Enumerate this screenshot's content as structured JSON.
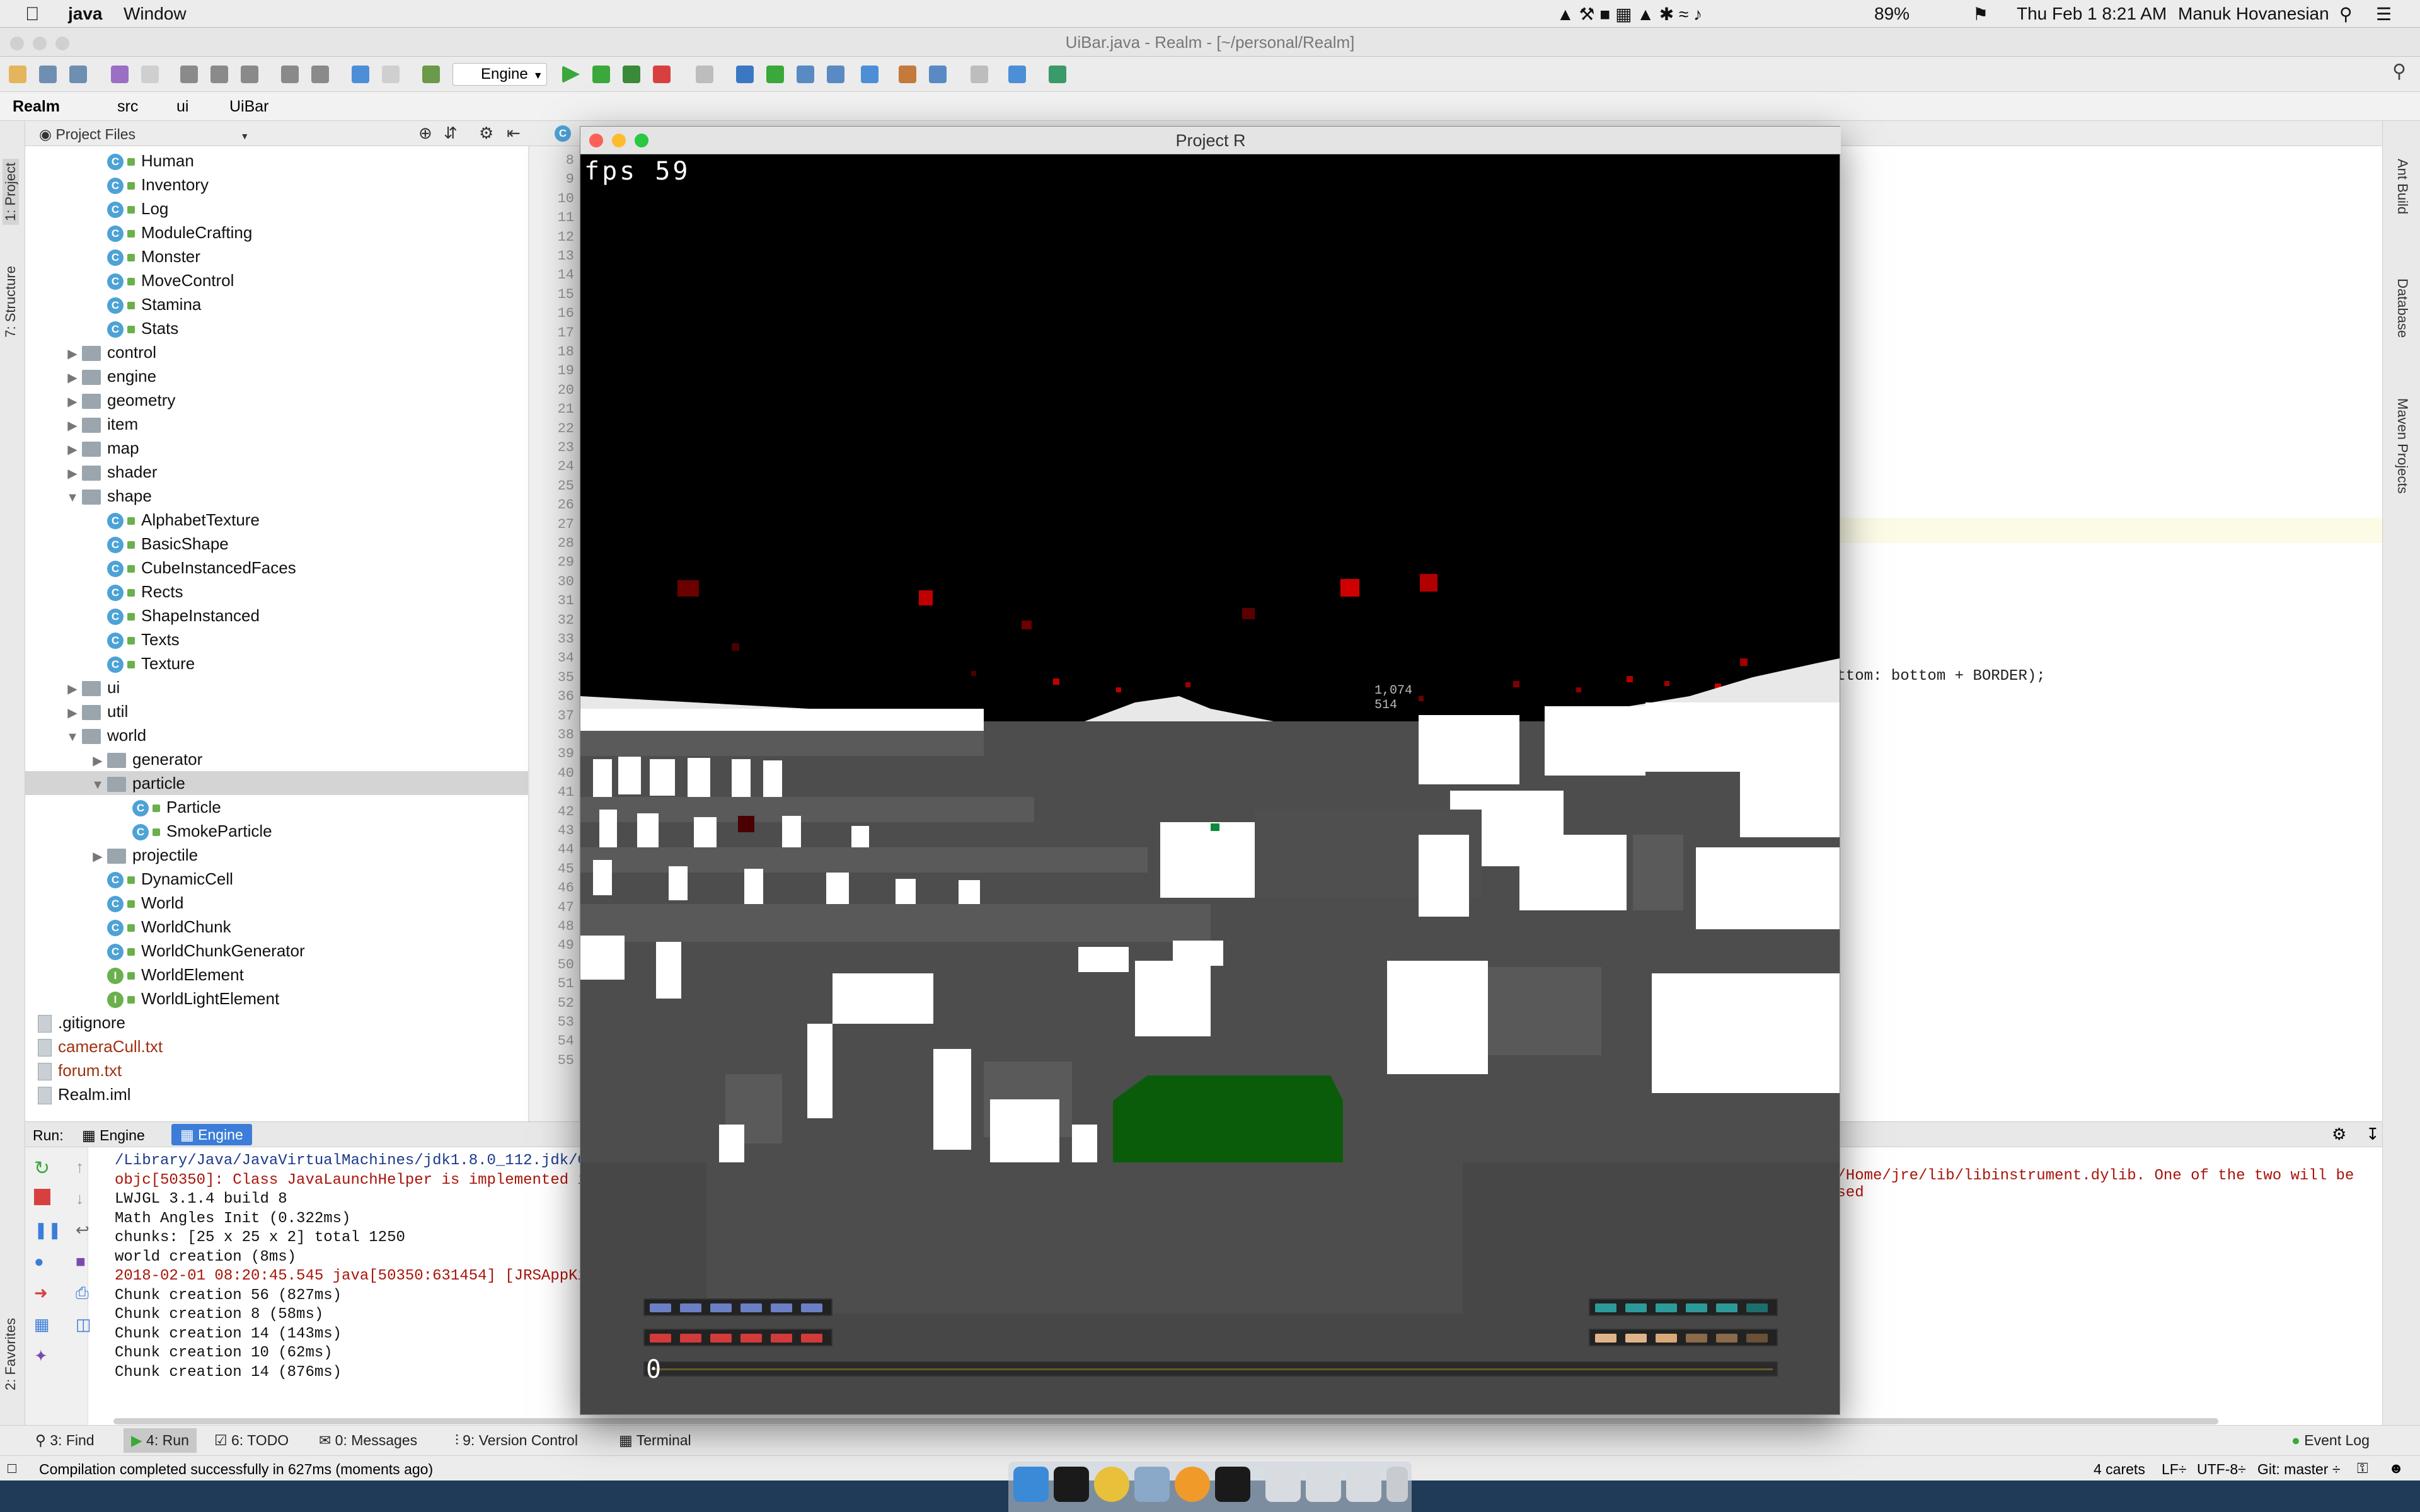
{
  "menubar": {
    "app": "java",
    "menu": "Window",
    "battery": "89%",
    "clock": "Thu Feb 1  8:21 AM",
    "user": "Manuk Hovanesian"
  },
  "ide": {
    "title": "UiBar.java - Realm - [~/personal/Realm]",
    "run_config": "Engine",
    "breadcrumb": [
      "Realm",
      "src",
      "ui",
      "UiBar"
    ],
    "project_view": "Project Files",
    "left_tabs": [
      "1: Project",
      "7: Structure",
      "2: Favorites"
    ],
    "right_tabs": [
      "Ant Build",
      "Database",
      "Maven Projects"
    ]
  },
  "tree": [
    {
      "label": "Human",
      "kind": "class",
      "indent": 3
    },
    {
      "label": "Inventory",
      "kind": "class",
      "indent": 3
    },
    {
      "label": "Log",
      "kind": "class",
      "indent": 3
    },
    {
      "label": "ModuleCrafting",
      "kind": "class",
      "indent": 3
    },
    {
      "label": "Monster",
      "kind": "class",
      "indent": 3
    },
    {
      "label": "MoveControl",
      "kind": "class",
      "indent": 3
    },
    {
      "label": "Stamina",
      "kind": "class",
      "indent": 3
    },
    {
      "label": "Stats",
      "kind": "class",
      "indent": 3
    },
    {
      "label": "control",
      "kind": "folder",
      "indent": 2,
      "arrow": "right"
    },
    {
      "label": "engine",
      "kind": "folder",
      "indent": 2,
      "arrow": "right"
    },
    {
      "label": "geometry",
      "kind": "folder",
      "indent": 2,
      "arrow": "right"
    },
    {
      "label": "item",
      "kind": "folder",
      "indent": 2,
      "arrow": "right"
    },
    {
      "label": "map",
      "kind": "folder",
      "indent": 2,
      "arrow": "right"
    },
    {
      "label": "shader",
      "kind": "folder",
      "indent": 2,
      "arrow": "right"
    },
    {
      "label": "shape",
      "kind": "folder",
      "indent": 2,
      "arrow": "down"
    },
    {
      "label": "AlphabetTexture",
      "kind": "class",
      "indent": 3
    },
    {
      "label": "BasicShape",
      "kind": "class",
      "indent": 3
    },
    {
      "label": "CubeInstancedFaces",
      "kind": "class",
      "indent": 3
    },
    {
      "label": "Rects",
      "kind": "class",
      "indent": 3
    },
    {
      "label": "ShapeInstanced",
      "kind": "class",
      "indent": 3
    },
    {
      "label": "Texts",
      "kind": "class",
      "indent": 3
    },
    {
      "label": "Texture",
      "kind": "class",
      "indent": 3
    },
    {
      "label": "ui",
      "kind": "folder",
      "indent": 2,
      "arrow": "right"
    },
    {
      "label": "util",
      "kind": "folder",
      "indent": 2,
      "arrow": "right"
    },
    {
      "label": "world",
      "kind": "folder",
      "indent": 2,
      "arrow": "down"
    },
    {
      "label": "generator",
      "kind": "folder",
      "indent": 3,
      "arrow": "right"
    },
    {
      "label": "particle",
      "kind": "folder",
      "indent": 3,
      "arrow": "down",
      "selected": true
    },
    {
      "label": "Particle",
      "kind": "class",
      "indent": 4
    },
    {
      "label": "SmokeParticle",
      "kind": "class",
      "indent": 4
    },
    {
      "label": "projectile",
      "kind": "folder",
      "indent": 3,
      "arrow": "right"
    },
    {
      "label": "DynamicCell",
      "kind": "class",
      "indent": 3
    },
    {
      "label": "World",
      "kind": "class",
      "indent": 3
    },
    {
      "label": "WorldChunk",
      "kind": "class",
      "indent": 3
    },
    {
      "label": "WorldChunkGenerator",
      "kind": "class",
      "indent": 3
    },
    {
      "label": "WorldElement",
      "kind": "interface",
      "indent": 3
    },
    {
      "label": "WorldLightElement",
      "kind": "interface",
      "indent": 3
    },
    {
      "label": ".gitignore",
      "kind": "file",
      "indent": 1
    },
    {
      "label": "cameraCull.txt",
      "kind": "file",
      "indent": 1,
      "color": "#a03010"
    },
    {
      "label": "forum.txt",
      "kind": "file",
      "indent": 1,
      "color": "#a03010"
    },
    {
      "label": "Realm.iml",
      "kind": "file",
      "indent": 1
    }
  ],
  "editor": {
    "line_numbers": [
      "8",
      "9",
      "10",
      "11",
      "12",
      "13",
      "14",
      "15",
      "16",
      "17",
      "18",
      "19",
      "20",
      "21",
      "22",
      "23",
      "24",
      "25",
      "26",
      "27",
      "28",
      "29",
      "30",
      "31",
      "32",
      "33",
      "34",
      "35",
      "36",
      "37",
      "38",
      "39",
      "40",
      "41",
      "42",
      "43",
      "44",
      "45",
      "46",
      "47",
      "48",
      "49",
      "50",
      "51",
      "52",
      "53",
      "54",
      "55"
    ],
    "visible_code": "ottom: bottom + BORDER);"
  },
  "run": {
    "label": "Run:",
    "tabs": [
      "Engine",
      "Engine"
    ],
    "lines": [
      {
        "text": "/Library/Java/JavaVirtualMachines/jdk1.8.0_112.jdk/Co",
        "red": false,
        "color": "#1a3a8a"
      },
      {
        "text": "objc[50350]: Class JavaLaunchHelper is implemented in",
        "red": true
      },
      {
        "text": "LWJGL 3.1.4 build 8",
        "red": false
      },
      {
        "text": "Math Angles Init (0.322ms)",
        "red": false
      },
      {
        "text": "chunks: [25 x 25 x 2] total 1250",
        "red": false
      },
      {
        "text": "world creation (8ms)",
        "red": false
      },
      {
        "text": "2018-02-01 08:20:45.545 java[50350:631454] [JRSAppKit",
        "red": true
      },
      {
        "text": "Chunk creation 56 (827ms)",
        "red": false
      },
      {
        "text": "Chunk creation 8 (58ms)",
        "red": false
      },
      {
        "text": "Chunk creation 14 (143ms)",
        "red": false
      },
      {
        "text": "Chunk creation 10 (62ms)",
        "red": false
      },
      {
        "text": "Chunk creation 14 (876ms)",
        "red": false
      }
    ],
    "right_overflow": "s/Home/jre/lib/libinstrument.dylib. One of the two will be used"
  },
  "bottom_tabs": [
    "3: Find",
    "4: Run",
    "6: TODO",
    "0: Messages",
    "9: Version Control",
    "Terminal"
  ],
  "event_log": "Event Log",
  "status": {
    "message": "Compilation completed successfully in 627ms (moments ago)",
    "carets": "4 carets",
    "line_sep": "LF÷",
    "encoding": "UTF-8÷",
    "git": "Git: master ÷"
  },
  "game": {
    "title": "Project R",
    "fps": "fps 59",
    "coord_line1": "1,074",
    "coord_line2": "514",
    "hud_counter": "0"
  },
  "colors": {
    "accent": "#4da2d6",
    "selection": "#d4d4d4",
    "health": "#d23b3b",
    "mana": "#6b7fc4",
    "stamina": "#2d9a9a",
    "food": "#e0b48a",
    "player": "#0a5c0a"
  }
}
